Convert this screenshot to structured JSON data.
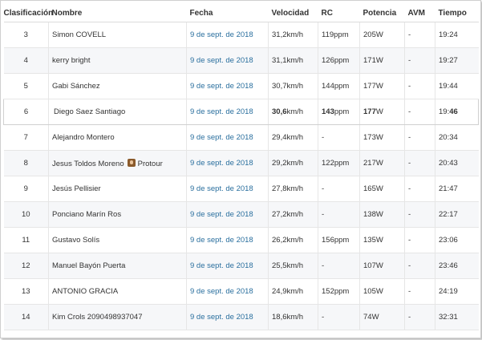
{
  "headers": {
    "rank": "Clasificación",
    "name": "Nombre",
    "date": "Fecha",
    "speed": "Velocidad",
    "hr": "RC",
    "power": "Potencia",
    "vam": "AVM",
    "time": "Tiempo"
  },
  "rows": [
    {
      "rank": "3",
      "name": "Simon COVELL",
      "date": "9 de sept. de 2018",
      "speed": "31,2km/h",
      "hr": "119ppm",
      "power": "205W",
      "vam": "-",
      "time": "19:24"
    },
    {
      "rank": "4",
      "name": "kerry bright",
      "date": "9 de sept. de 2018",
      "speed": "31,1km/h",
      "hr": "126ppm",
      "power": "171W",
      "vam": "-",
      "time": "19:27"
    },
    {
      "rank": "5",
      "name": "Gabi Sánchez",
      "date": "9 de sept. de 2018",
      "speed": "30,7km/h",
      "hr": "144ppm",
      "power": "177W",
      "vam": "-",
      "time": "19:44"
    },
    {
      "rank": "6",
      "name": "Diego Saez Santiago",
      "date": "9 de sept. de 2018",
      "speed_value": "30,6",
      "speed_unit": "km/h",
      "hr_value": "143",
      "hr_unit": "ppm",
      "power_value": "177",
      "power_unit": "W",
      "vam": "-",
      "time_prefix": "19:",
      "time_bold": "46",
      "highlighted": true
    },
    {
      "rank": "7",
      "name": "Alejandro Montero",
      "date": "9 de sept. de 2018",
      "speed": "29,4km/h",
      "hr": "-",
      "power": "173W",
      "vam": "-",
      "time": "20:34"
    },
    {
      "rank": "8",
      "name": "Jesus Toldos Moreno",
      "badge_label": "Protour",
      "badge_icon": "protour-badge-icon",
      "date": "9 de sept. de 2018",
      "speed": "29,2km/h",
      "hr": "122ppm",
      "power": "217W",
      "vam": "-",
      "time": "20:43"
    },
    {
      "rank": "9",
      "name": "Jesús Pellisier",
      "date": "9 de sept. de 2018",
      "speed": "27,8km/h",
      "hr": "-",
      "power": "165W",
      "vam": "-",
      "time": "21:47"
    },
    {
      "rank": "10",
      "name": "Ponciano Marín Ros",
      "date": "9 de sept. de 2018",
      "speed": "27,2km/h",
      "hr": "-",
      "power": "138W",
      "vam": "-",
      "time": "22:17"
    },
    {
      "rank": "11",
      "name": "Gustavo Solís",
      "date": "9 de sept. de 2018",
      "speed": "26,2km/h",
      "hr": "156ppm",
      "power": "135W",
      "vam": "-",
      "time": "23:06"
    },
    {
      "rank": "12",
      "name": "Manuel Bayón Puerta",
      "date": "9 de sept. de 2018",
      "speed": "25,5km/h",
      "hr": "-",
      "power": "107W",
      "vam": "-",
      "time": "23:46"
    },
    {
      "rank": "13",
      "name": "ANTONIO GRACIA",
      "date": "9 de sept. de 2018",
      "speed": "24,9km/h",
      "hr": "152ppm",
      "power": "105W",
      "vam": "-",
      "time": "24:19"
    },
    {
      "rank": "14",
      "name": "Kim Crols 2090498937047",
      "date": "9 de sept. de 2018",
      "speed": "18,6km/h",
      "hr": "-",
      "power": "74W",
      "vam": "-",
      "time": "32:31"
    }
  ],
  "colors": {
    "link": "#2a6f9e",
    "row_alt": "#f6f7f9"
  }
}
